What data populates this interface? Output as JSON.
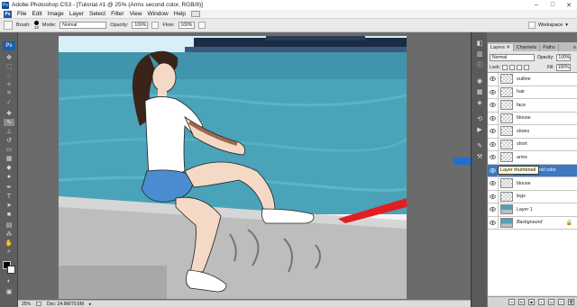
{
  "titlebar": {
    "title": "Adobe Photoshop CS3 - [Tutorial #1 @ 25% (Arms second color, RGB/8)]",
    "app_badge": "Ps"
  },
  "menubar": {
    "items": [
      "File",
      "Edit",
      "Image",
      "Layer",
      "Select",
      "Filter",
      "View",
      "Window",
      "Help"
    ]
  },
  "options": {
    "brush_label": "Brush:",
    "brush_size": "13",
    "mode_label": "Mode:",
    "mode_value": "Normal",
    "opacity_label": "Opacity:",
    "opacity_value": "100%",
    "flow_label": "Flow:",
    "flow_value": "100%",
    "workspace_label": "Workspace"
  },
  "toolbox": {
    "logo": "Ps"
  },
  "statusbar": {
    "zoom": "25%",
    "doc": "Doc: 24.9M/70.6M"
  },
  "layers_panel": {
    "tabs": [
      "Layers",
      "Channels",
      "Paths"
    ],
    "blend_mode": "Normal",
    "opacity_label": "Opacity:",
    "opacity_value": "100%",
    "lock_label": "Lock:",
    "fill_label": "Fill:",
    "fill_value": "100%",
    "layers": [
      {
        "name": "outline",
        "active": false
      },
      {
        "name": "hair",
        "active": false
      },
      {
        "name": "face",
        "active": false
      },
      {
        "name": "blouse",
        "active": false
      },
      {
        "name": "shoes",
        "active": false
      },
      {
        "name": "short",
        "active": false
      },
      {
        "name": "arms",
        "active": false
      },
      {
        "name": "Arms second color",
        "active": true
      },
      {
        "name": "blouse",
        "active": false
      },
      {
        "name": "legs",
        "active": false
      },
      {
        "name": "Layer 1",
        "active": false
      },
      {
        "name": "Background",
        "active": false
      }
    ],
    "tooltip": "Layer thumbnail"
  },
  "colors": {
    "active_layer": "#3d78c2",
    "arrow": "#1f6fd0",
    "sea": "#4aa3b8",
    "sky": "#cfe8f5"
  }
}
